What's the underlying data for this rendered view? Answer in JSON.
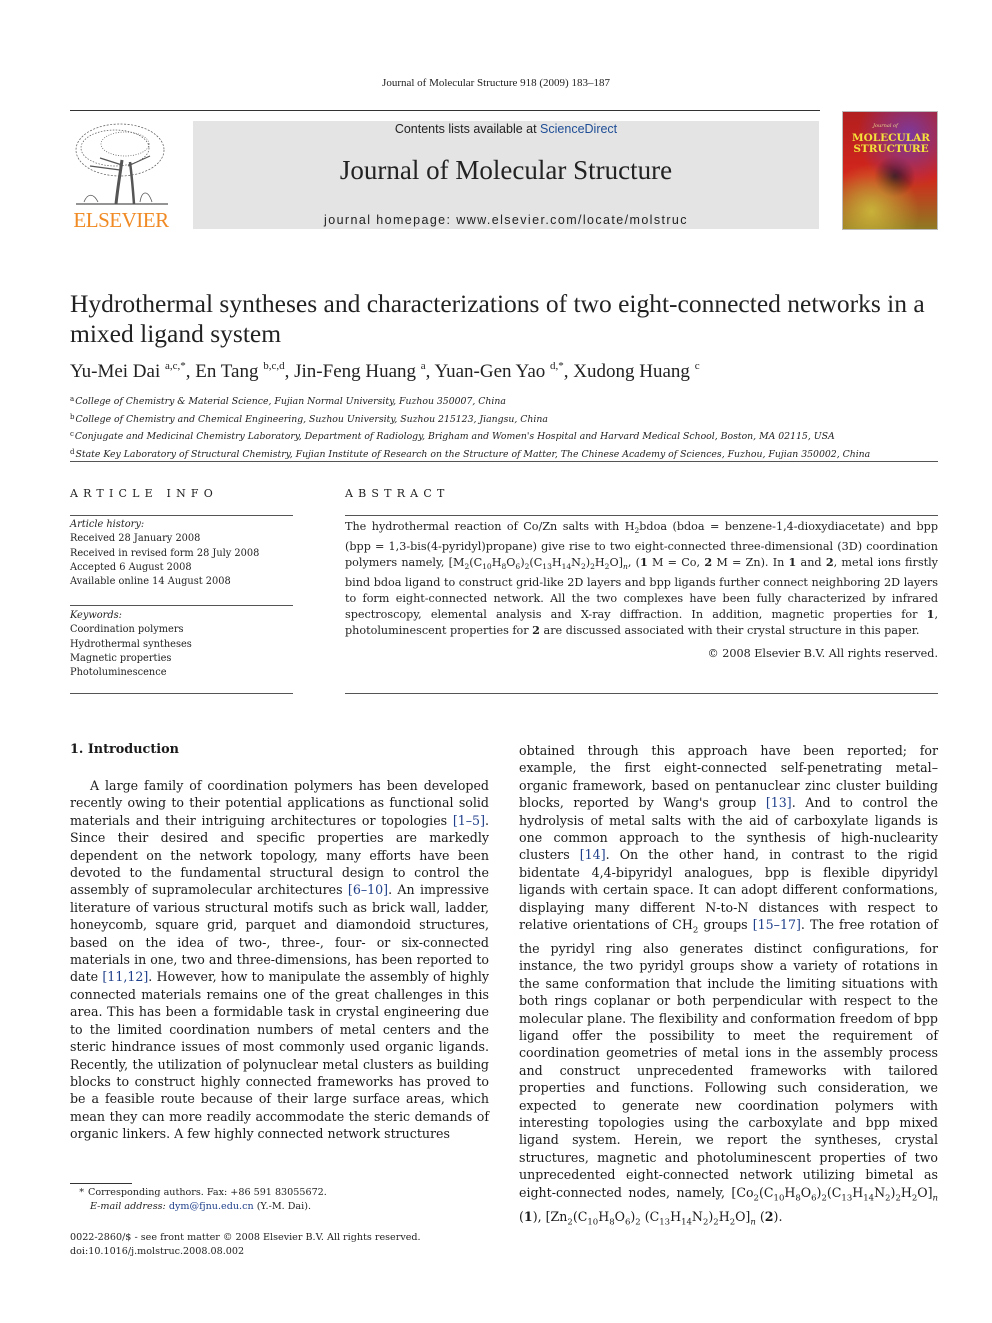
{
  "running_head": "Journal of Molecular Structure 918 (2009) 183–187",
  "publisher": {
    "logo_word": "ELSEVIER",
    "logo_icon": "elsevier-tree-icon",
    "brand_color": "#f08a24"
  },
  "banner": {
    "contents_prefix": "Contents lists available at ",
    "contents_link": "ScienceDirect",
    "journal_title": "Journal of Molecular Structure",
    "homepage": "journal homepage: www.elsevier.com/locate/molstruc",
    "background": "#e4e4e4",
    "link_color": "#1f4e96"
  },
  "cover": {
    "small_text": "Journal of",
    "title_line1": "MOLECULAR",
    "title_line2": "STRUCTURE"
  },
  "article": {
    "title": "Hydrothermal syntheses and characterizations of two eight-connected networks in a mixed ligand system",
    "authors": [
      {
        "name": "Yu-Mei Dai",
        "sup": "a,c,*",
        "sep": ", "
      },
      {
        "name": "En Tang",
        "sup": "b,c,d",
        "sep": ", "
      },
      {
        "name": "Jin-Feng Huang",
        "sup": "a",
        "sep": ", "
      },
      {
        "name": "Yuan-Gen Yao",
        "sup": "d,*",
        "sep": ", "
      },
      {
        "name": "Xudong Huang",
        "sup": "c",
        "sep": ""
      }
    ],
    "affiliations": [
      {
        "key": "a",
        "text": "College of Chemistry & Material Science, Fujian Normal University, Fuzhou 350007, China"
      },
      {
        "key": "b",
        "text": "College of Chemistry and Chemical Engineering, Suzhou University, Suzhou 215123, Jiangsu, China"
      },
      {
        "key": "c",
        "text": "Conjugate and Medicinal Chemistry Laboratory, Department of Radiology, Brigham and Women's Hospital and Harvard Medical School, Boston, MA 02115, USA"
      },
      {
        "key": "d",
        "text": "State Key Laboratory of Structural Chemistry, Fujian Institute of Research on the Structure of Matter, The Chinese Academy of Sciences, Fuzhou, Fujian 350002, China"
      }
    ]
  },
  "article_info": {
    "heading": "ARTICLE INFO",
    "history_label": "Article history:",
    "history": [
      "Received 28 January 2008",
      "Received in revised form 28 July 2008",
      "Accepted 6 August 2008",
      "Available online 14 August 2008"
    ],
    "keywords_label": "Keywords:",
    "keywords": [
      "Coordination polymers",
      "Hydrothermal syntheses",
      "Magnetic properties",
      "Photoluminescence"
    ]
  },
  "abstract": {
    "heading": "ABSTRACT",
    "p1": "The hydrothermal reaction of Co/Zn salts with H",
    "p1_sub": "2",
    "p2": "bdoa (bdoa = benzene-1,4-dioxydiacetate) and bpp (bpp = 1,3-bis(4-pyridyl)propane) give rise to two eight-connected three-dimensional (3D) coordination polymers namely, [M",
    "formula_subs": [
      "2",
      "10",
      "8",
      "6",
      "2",
      "13",
      "14",
      "2",
      "2",
      "2"
    ],
    "p3": ", (",
    "cmpd1": "1",
    "p4": " M = Co, ",
    "cmpd2": "2",
    "p5": " M = Zn). In ",
    "p6": " and ",
    "p7": ", metal ions firstly bind bdoa ligand to construct grid-like 2D layers and bpp ligands further connect neighboring 2D layers to form eight-connected network. All the two complexes have been fully characterized by infrared spectroscopy, elemental analysis and X-ray diffraction. In addition, magnetic properties for ",
    "p8": ", photoluminescent properties for ",
    "p9": " are discussed associated with their crystal structure in this paper.",
    "copyright": "© 2008 Elsevier B.V. All rights reserved."
  },
  "intro": {
    "heading": "1. Introduction",
    "left": [
      "A large family of coordination polymers has been developed recently owing to their potential applications as functional solid materials and their intriguing architectures or topologies ",
      "[1–5]",
      ". Since their desired and specific properties are markedly dependent on the network topology, many efforts have been devoted to the fundamental structural design to control the assembly of supramolecular architectures ",
      "[6–10]",
      ". An impressive literature of various structural motifs such as brick wall, ladder, honeycomb, square grid, parquet and diamondoid structures, based on the idea of two-, three-, four- or six-connected materials in one, two and three-dimensions, has been reported to date ",
      "[11,12]",
      ". However, how to manipulate the assembly of highly connected materials remains one of the great challenges in this area. This has been a formidable task in crystal engineering due to the limited coordination numbers of metal centers and the steric hindrance issues of most commonly used organic ligands. Recently, the utilization of polynuclear metal clusters as building blocks to construct highly connected frameworks has proved to be a feasible route because of their large surface areas, which mean they can more readily accommodate the steric demands of organic linkers. A few highly connected network structures"
    ],
    "right": [
      "obtained through this approach have been reported; for example, the first eight-connected self-penetrating metal–organic framework, based on pentanuclear zinc cluster building blocks, reported by Wang's group ",
      "[13]",
      ". And to control the hydrolysis of metal salts with the aid of carboxylate ligands is one common approach to the synthesis of high-nuclearity clusters ",
      "[14]",
      ". On the other hand, in contrast to the rigid bidentate 4,4-bipyridyl analogues, bpp is flexible dipyridyl ligands with certain space. It can adopt different conformations, displaying many different N-to-N distances with respect to relative orientations of CH",
      "2",
      " groups ",
      "[15–17]",
      ". The free rotation of the pyridyl ring also generates distinct configurations, for instance, the two pyridyl groups show a variety of rotations in the same conformation that include the limiting situations with both rings coplanar or both perpendicular with respect to the molecular plane. The flexibility and conformation freedom of bpp ligand offer the possibility to meet the requirement of coordination geometries of metal ions in the assembly process and construct unprecedented frameworks with tailored properties and functions. Following such consideration, we expected to generate new coordination polymers with interesting topologies using the carboxylate and bpp mixed ligand system. Herein, we report the syntheses, crystal structures, magnetic and photoluminescent properties of two unprecedented eight-connected network utilizing bimetal as eight-connected nodes, namely, ",
      " (",
      "1",
      "), ",
      " (",
      "2",
      ")."
    ],
    "ref_color": "#1f3f8a"
  },
  "footnotes": {
    "star": "*",
    "corresponding": "Corresponding authors. Fax: +86 591 83055672.",
    "email_label": "E-mail address:",
    "email": "dym@fjnu.edu.cn",
    "email_suffix": " (Y.-M. Dai).",
    "frontmatter": "0022-2860/$ - see front matter © 2008 Elsevier B.V. All rights reserved.",
    "doi": "doi:10.1016/j.molstruc.2008.08.002"
  }
}
